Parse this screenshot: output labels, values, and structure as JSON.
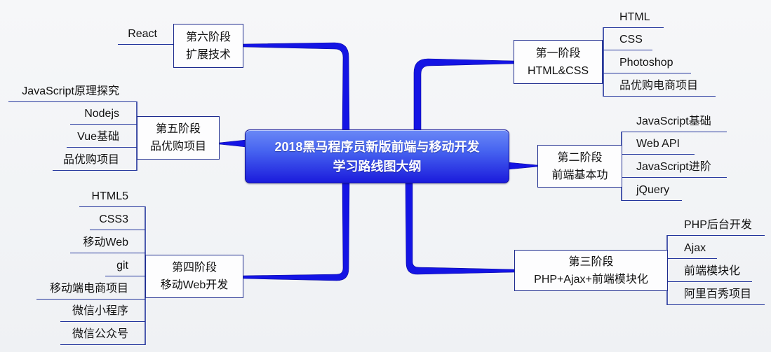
{
  "center": {
    "line1": "2018黑马程序员新版前端与移动开发",
    "line2": "学习路线图大纲"
  },
  "stages": [
    {
      "title": "第一阶段",
      "subtitle": "HTML&CSS",
      "items": [
        "HTML",
        "CSS",
        "Photoshop",
        "品优购电商项目"
      ]
    },
    {
      "title": "第二阶段",
      "subtitle": "前端基本功",
      "items": [
        "JavaScript基础",
        "Web API",
        "JavaScript进阶",
        "jQuery"
      ]
    },
    {
      "title": "第三阶段",
      "subtitle": "PHP+Ajax+前端模块化",
      "items": [
        "PHP后台开发",
        "Ajax",
        "前端模块化",
        "阿里百秀项目"
      ]
    },
    {
      "title": "第四阶段",
      "subtitle": "移动Web开发",
      "items": [
        "HTML5",
        "CSS3",
        "移动Web",
        "git",
        "移动端电商项目",
        "微信小程序",
        "微信公众号"
      ]
    },
    {
      "title": "第五阶段",
      "subtitle": "品优购项目",
      "items": [
        "JavaScript原理探究",
        "Nodejs",
        "Vue基础",
        "品优购项目"
      ]
    },
    {
      "title": "第六阶段",
      "subtitle": "扩展技术",
      "items": [
        "React"
      ]
    }
  ],
  "colors": {
    "connector": "#1414e4",
    "line": "#22349c",
    "center_top": "#6a88f6",
    "center_bottom": "#1b1bdc",
    "box_border": "#1d2b8e"
  }
}
